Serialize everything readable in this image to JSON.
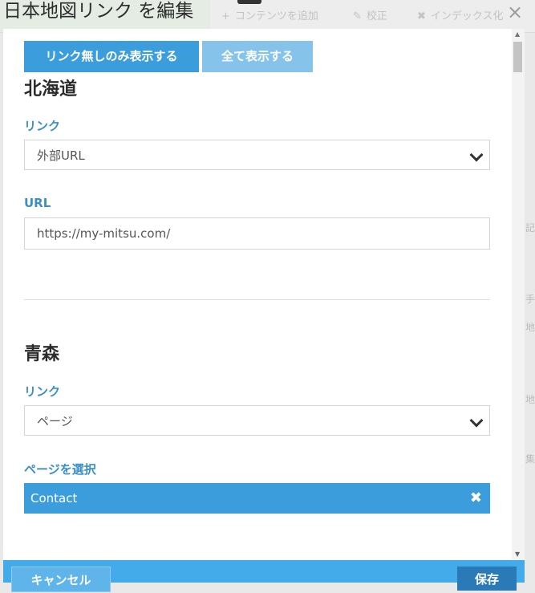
{
  "background": {
    "toolbar": {
      "add_content": "コンテンツを追加",
      "proofread": "校正",
      "index": "インデックス化"
    },
    "side_fragments": [
      "記",
      "手",
      "地",
      "地",
      "集"
    ]
  },
  "modal": {
    "title": "日本地図リンク を編集",
    "close": "×",
    "filter_buttons": {
      "linkless_only": "リンク無しのみ表示する",
      "show_all": "全て表示する"
    },
    "sections": [
      {
        "title": "北海道",
        "link_label": "リンク",
        "link_value": "外部URL",
        "url_label": "URL",
        "url_value": "https://my-mitsu.com/"
      },
      {
        "title": "青森",
        "link_label": "リンク",
        "link_value": "ページ",
        "page_label": "ページを選択",
        "page_value": "Contact",
        "remove": "✖"
      }
    ],
    "footer": {
      "cancel": "キャンセル",
      "save": "保存"
    }
  },
  "icons": {
    "plus": "+",
    "edit": "✎",
    "x": "✖",
    "up": "▲",
    "down": "▼"
  }
}
